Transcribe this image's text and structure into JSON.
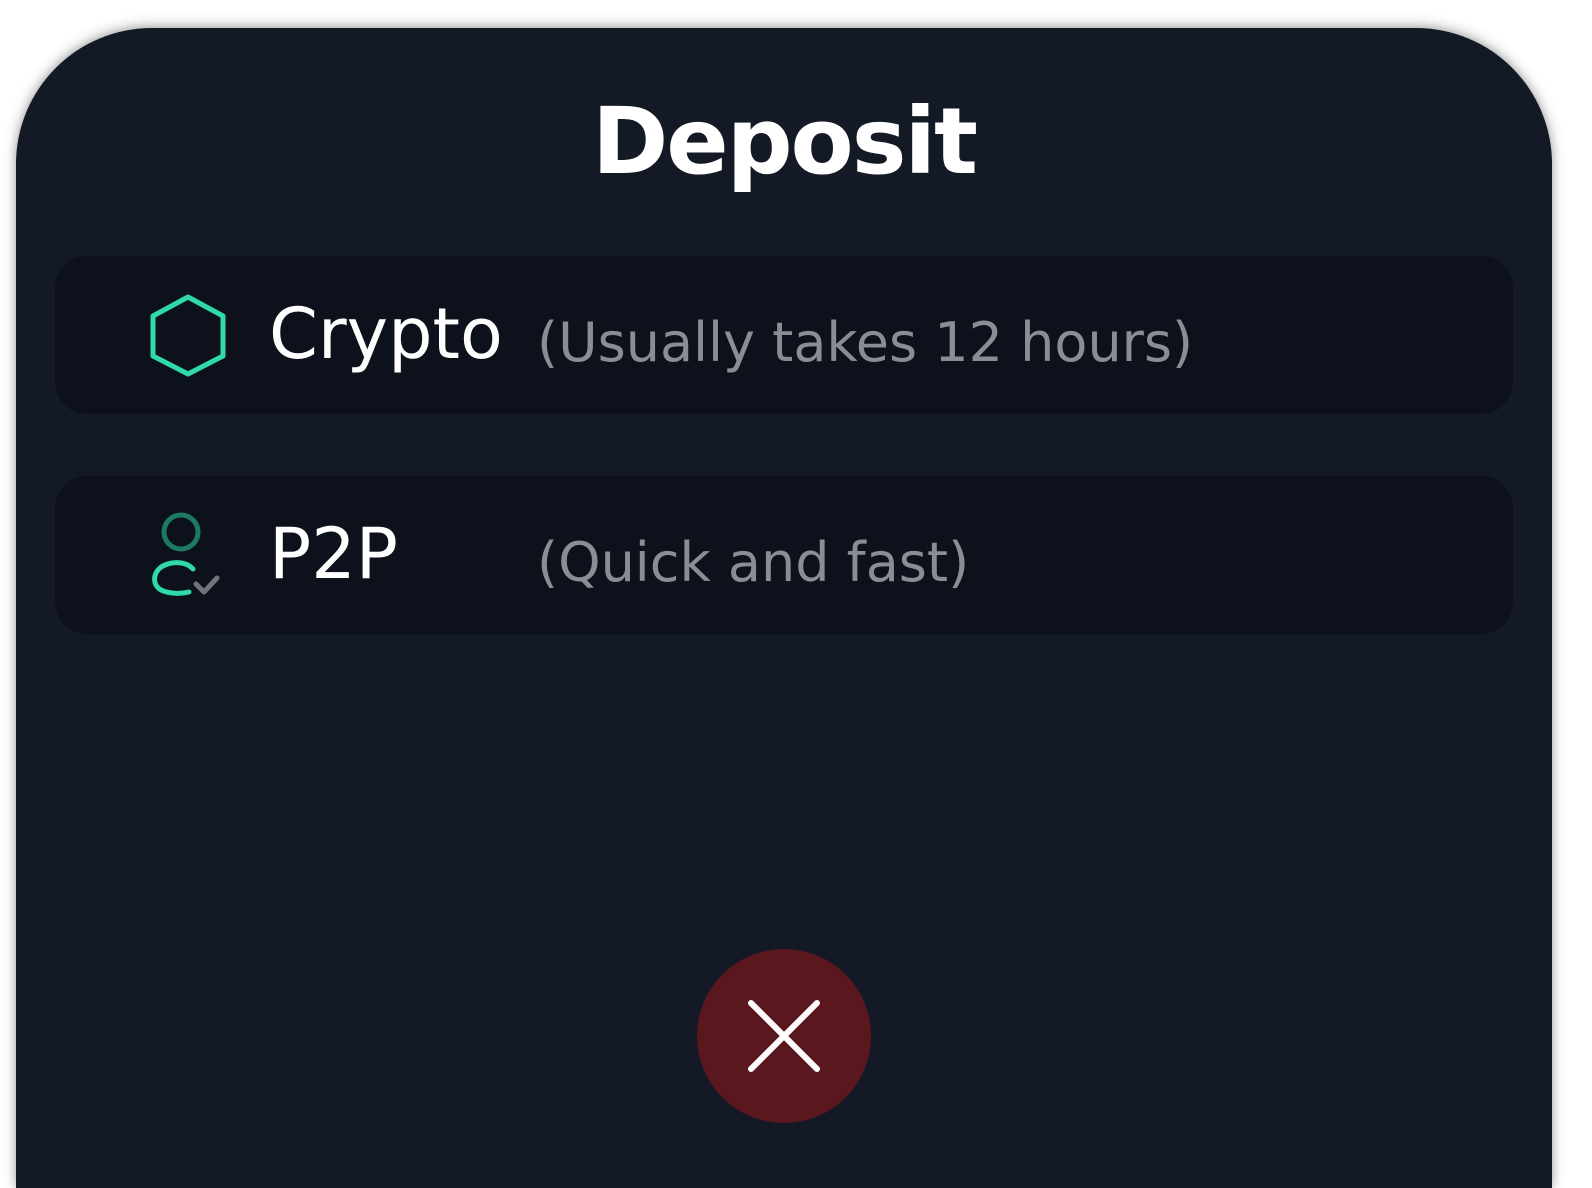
{
  "sheet": {
    "title": "Deposit",
    "background_color": "#141a25",
    "card_color": "#0c111b",
    "accent_color": "#2fd9a9"
  },
  "options": [
    {
      "icon": "hexagon-icon",
      "label": "Crypto",
      "note": "(Usually takes 12 hours)"
    },
    {
      "icon": "user-verified-icon",
      "label": "P2P",
      "note": "(Quick and fast)"
    }
  ],
  "close_button": {
    "icon": "close-icon",
    "color": "#5a171e"
  }
}
